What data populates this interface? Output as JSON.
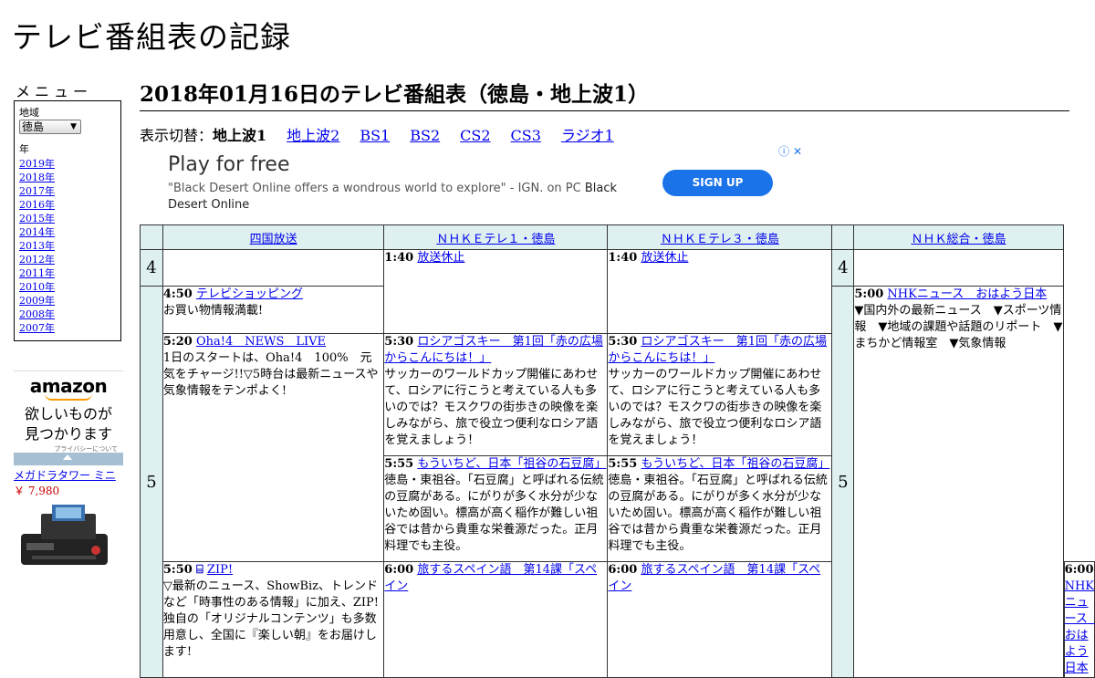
{
  "site_title": "テレビ番組表の記録",
  "sidebar": {
    "menu_heading": "メニュー",
    "region_label": "地域",
    "region_value": "徳島",
    "year_label": "年",
    "years": [
      "2019年",
      "2018年",
      "2017年",
      "2016年",
      "2015年",
      "2014年",
      "2013年",
      "2012年",
      "2011年",
      "2010年",
      "2009年",
      "2008年",
      "2007年"
    ],
    "amazon": {
      "logo": "amazon",
      "copy_line1": "欲しいものが",
      "copy_line2": "見つかります",
      "privacy": "プライバシーについて",
      "product_name": "メガドラタワー ミニ",
      "product_price": "￥ 7,980"
    }
  },
  "page_title": "2018年01月16日のテレビ番組表（徳島・地上波1）",
  "switcher": {
    "label": "表示切替：",
    "current": "地上波1",
    "links": [
      "地上波2",
      "BS1",
      "BS2",
      "CS2",
      "CS3",
      "ラジオ1"
    ]
  },
  "ad": {
    "headline": "Play for free",
    "body": "\"Black Desert Online offers a wondrous world to explore\" - IGN. on PC",
    "body_brand": "Black Desert Online",
    "button": "SIGN UP",
    "icons": "ⓘ ✕"
  },
  "schedule": {
    "channels": [
      "四国放送",
      "ＮＨＫＥテレ１・徳島",
      "ＮＨＫＥテレ３・徳島",
      "ＮＨＫ総合・徳島"
    ],
    "hour4": "4",
    "hour5": "5",
    "ch1": [
      {
        "time": "4:50",
        "title": "テレビショッピング",
        "desc": "お買い物情報満載!"
      },
      {
        "time": "5:20",
        "title": "Oha!4　NEWS　LIVE",
        "desc": "1日のスタートは、Oha!4　100%　元気をチャージ!!▽5時台は最新ニュースや気象情報をテンポよく!"
      },
      {
        "time": "5:50",
        "title": "ZIP!",
        "desc": "▽最新のニュース、ShowBiz、トレンドなど「時事性のある情報」に加え、ZIP!独自の「オリジナルコンテンツ」も多数用意し、全国に『楽しい朝』をお届けします!"
      }
    ],
    "ch2": [
      {
        "time": "1:40",
        "title": "放送休止",
        "desc": ""
      },
      {
        "time": "5:30",
        "title": "ロシアゴスキー　第1回「赤の広場からこんにちは！」",
        "desc": "サッカーのワールドカップ開催にあわせて、ロシアに行こうと考えている人も多いのでは？モスクワの街歩きの映像を楽しみながら、旅で役立つ便利なロシア語を覚えましょう！"
      },
      {
        "time": "5:55",
        "title": "もういちど、日本「祖谷の石豆腐」",
        "desc": "徳島・東祖谷。「石豆腐」と呼ばれる伝統の豆腐がある。にがりが多く水分が少ないため固い。標高が高く稲作が難しい祖谷では昔から貴重な栄養源だった。正月料理でも主役。"
      },
      {
        "time": "6:00",
        "title": "旅するスペイン語　第14課「スペイン",
        "desc": ""
      }
    ],
    "ch3": [
      {
        "time": "1:40",
        "title": "放送休止",
        "desc": ""
      },
      {
        "time": "5:30",
        "title": "ロシアゴスキー　第1回「赤の広場からこんにちは！」",
        "desc": "サッカーのワールドカップ開催にあわせて、ロシアに行こうと考えている人も多いのでは？モスクワの街歩きの映像を楽しみながら、旅で役立つ便利なロシア語を覚えましょう！"
      },
      {
        "time": "5:55",
        "title": "もういちど、日本「祖谷の石豆腐」",
        "desc": "徳島・東祖谷。「石豆腐」と呼ばれる伝統の豆腐がある。にがりが多く水分が少ないため固い。標高が高く稲作が難しい祖谷では昔から貴重な栄養源だった。正月料理でも主役。"
      },
      {
        "time": "6:00",
        "title": "旅するスペイン語　第14課「スペイン",
        "desc": ""
      }
    ],
    "ch4": [
      {
        "time": "5:00",
        "title": "NHKニュース　おはよう日本",
        "desc": "▼国内外の最新ニュース　▼スポーツ情報　▼地域の課題や話題のリポート　▼まちかど情報室　▼気象情報"
      },
      {
        "time": "6:00",
        "title": "NHKニュース　おはよう日本",
        "desc": ""
      }
    ]
  }
}
